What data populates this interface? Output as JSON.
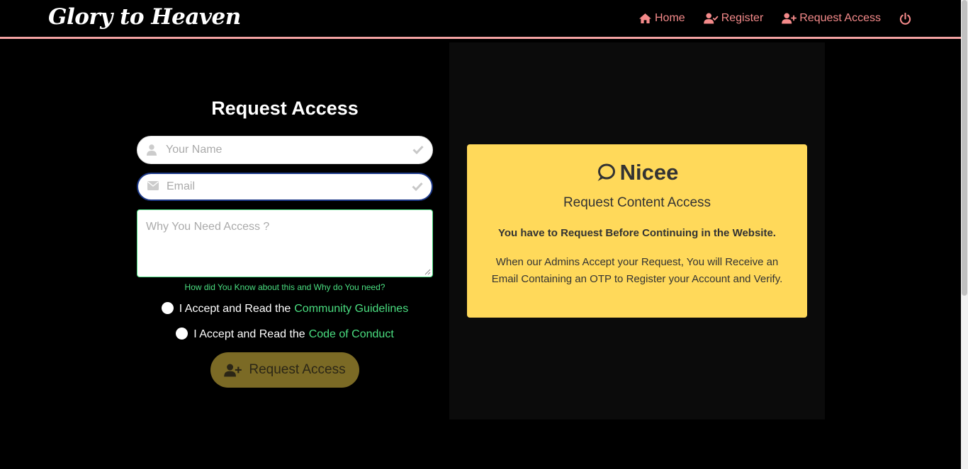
{
  "nav": {
    "brand": "Glory to Heaven",
    "links": [
      {
        "label": "Home",
        "icon": "home-icon"
      },
      {
        "label": "Register",
        "icon": "user-check-icon"
      },
      {
        "label": "Request Access",
        "icon": "user-plus-icon"
      }
    ],
    "power_icon": "power-icon",
    "accent_color": "#f48a8a"
  },
  "form": {
    "title": "Request Access",
    "name_placeholder": "Your Name",
    "email_placeholder": "Email",
    "reason_placeholder": "Why You Need Access ?",
    "help_text": "How did You Know about this and Why do You need?",
    "accept_community_prefix": "I Accept and Read the",
    "accept_community_link": "Community Guidelines",
    "accept_conduct_prefix": "I Accept and Read the",
    "accept_conduct_link": "Code of Conduct",
    "submit_label": "Request Access",
    "link_color": "#4ade80"
  },
  "card": {
    "heading": "Nicee",
    "subtitle": "Request Content Access",
    "bold_text": "You have to Request Before Continuing in the Website.",
    "body": "When our Admins Accept your Request, You will Receive an Email Containing an OTP to Register your Account and Verify.",
    "background": "#ffd95a"
  }
}
